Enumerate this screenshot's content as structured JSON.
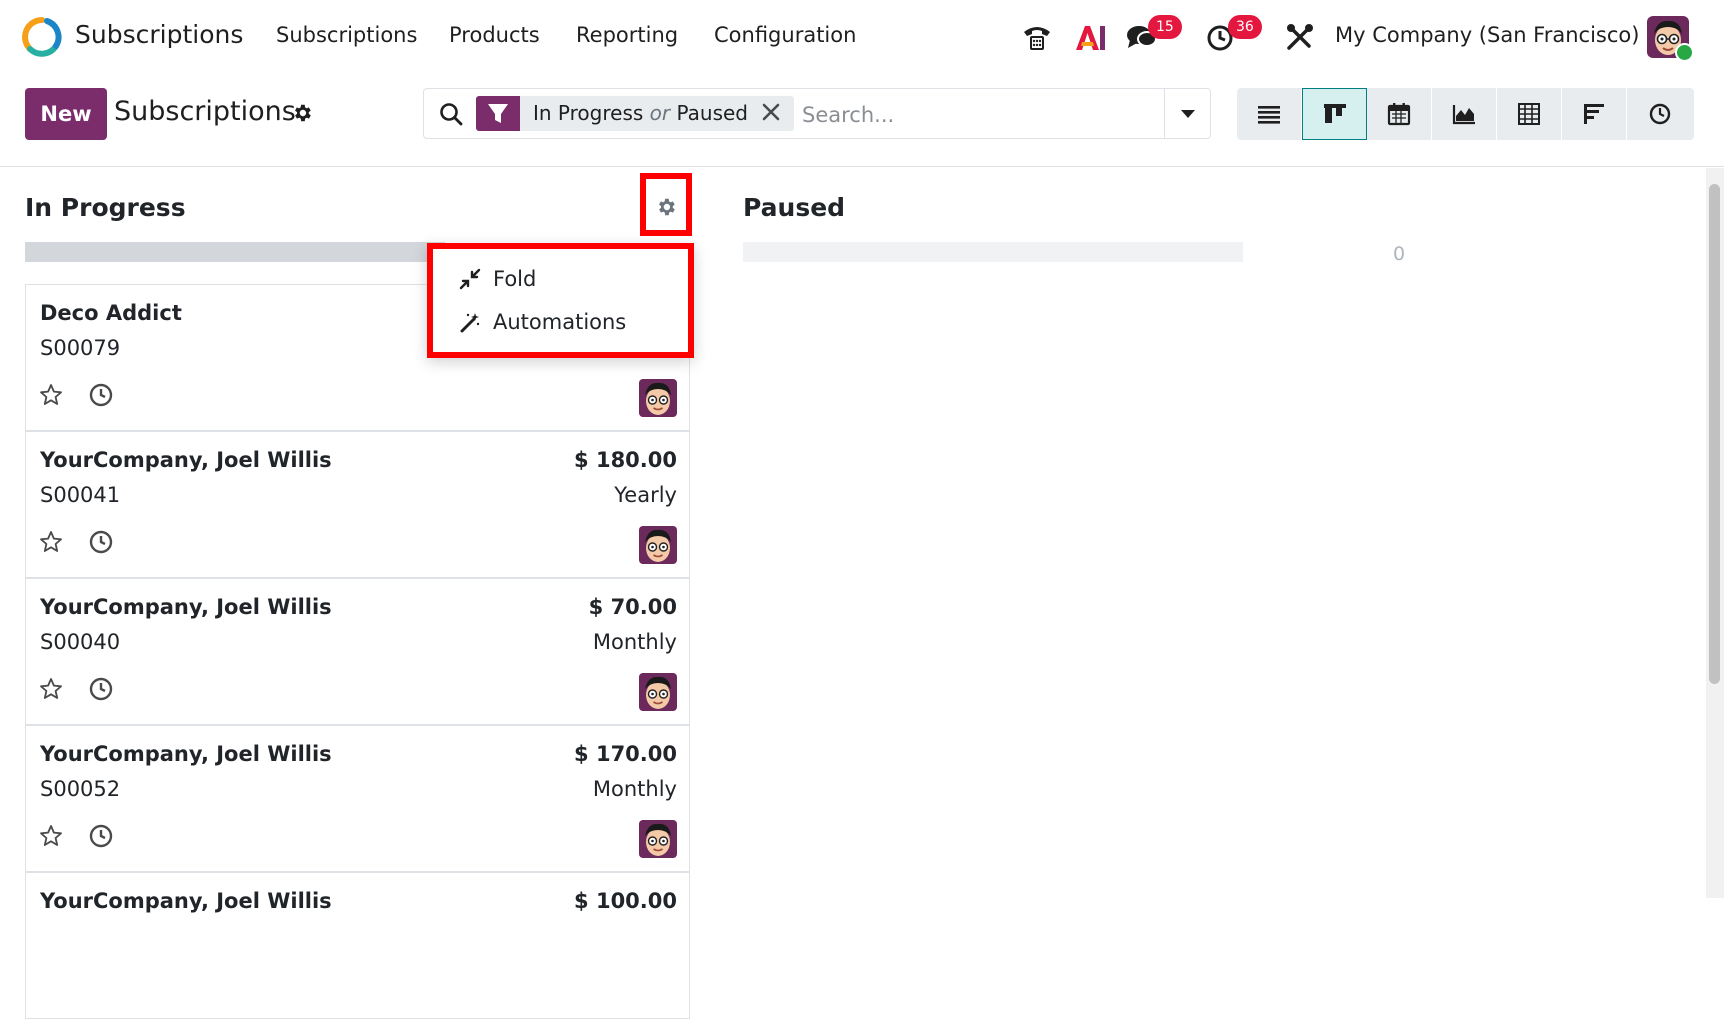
{
  "navbar": {
    "app_name": "Subscriptions",
    "app_logo_icon": "odoo-subscriptions-logo-icon",
    "menu": [
      "Subscriptions",
      "Products",
      "Reporting",
      "Configuration"
    ],
    "icons": [
      "phone-icon",
      "ai-icon",
      "chat-icon",
      "activity-clock-icon",
      "debug-tools-icon"
    ],
    "messages_badge": "15",
    "activities_badge": "36",
    "company": "My Company (San Francisco)"
  },
  "control": {
    "new_label": "New",
    "title": "Subscriptions",
    "facet": {
      "value1": "In Progress",
      "or": "or",
      "value2": "Paused"
    },
    "search_placeholder": "Search...",
    "views": [
      "list-view-icon",
      "kanban-view-icon",
      "calendar-view-icon",
      "graph-view-icon",
      "pivot-view-icon",
      "cohort-view-icon",
      "activity-view-icon"
    ],
    "active_view": "kanban-view-icon"
  },
  "columns": [
    {
      "title": "In Progress"
    },
    {
      "title": "Paused",
      "count": "0"
    }
  ],
  "dropdown": {
    "items": [
      {
        "label": "Fold",
        "icon": "compress-icon"
      },
      {
        "label": "Automations",
        "icon": "magic-wand-icon"
      }
    ]
  },
  "cards": [
    {
      "customer": "Deco Addict",
      "ref": "S00079",
      "amount": "",
      "period": ""
    },
    {
      "customer": "YourCompany, Joel Willis",
      "ref": "S00041",
      "amount": "$ 180.00",
      "period": "Yearly"
    },
    {
      "customer": "YourCompany, Joel Willis",
      "ref": "S00040",
      "amount": "$ 70.00",
      "period": "Monthly"
    },
    {
      "customer": "YourCompany, Joel Willis",
      "ref": "S00052",
      "amount": "$ 170.00",
      "period": "Monthly"
    },
    {
      "customer": "YourCompany, Joel Willis",
      "ref": "",
      "amount": "$ 100.00",
      "period": ""
    }
  ],
  "colors": {
    "brand": "#7b2c6b",
    "badge": "#e4173f",
    "highlight": "#ff0000",
    "active_view": "#017e84"
  }
}
